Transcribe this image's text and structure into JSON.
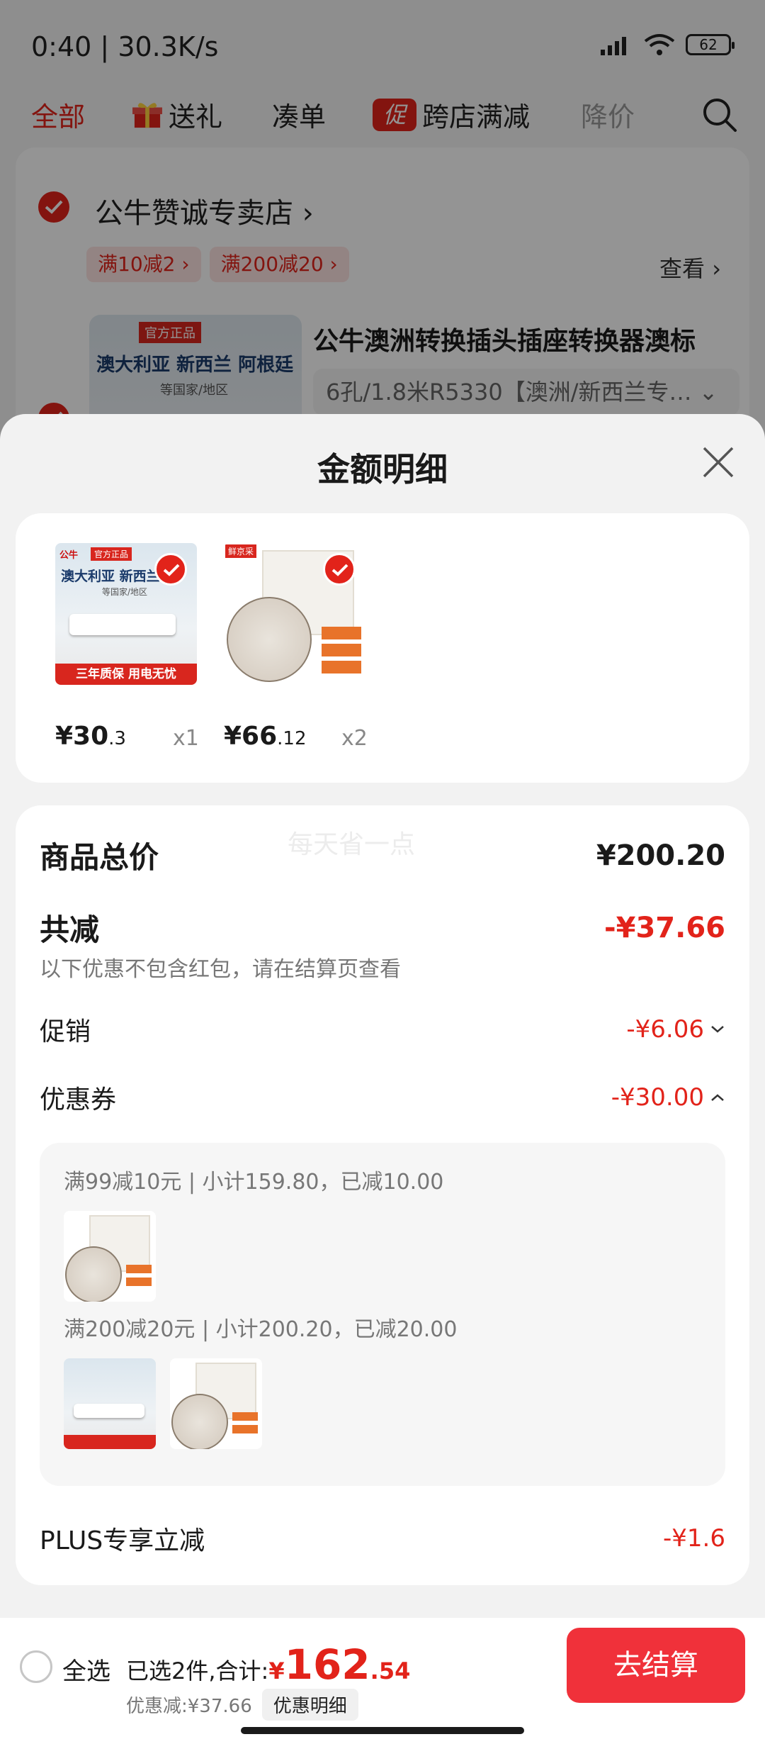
{
  "status_bar": {
    "time": "0:40",
    "speed": "30.3K/s",
    "battery": "62"
  },
  "tabs": [
    {
      "label": "全部"
    },
    {
      "label": "送礼"
    },
    {
      "label": "凑单"
    },
    {
      "label": "跨店满减",
      "badge": "促"
    },
    {
      "label": "降价"
    }
  ],
  "store": {
    "name": "公牛赞诚专卖店",
    "tags": [
      "满10减2",
      "满200减20"
    ],
    "view_label": "查看",
    "product_title": "公牛澳洲转换插头插座转换器澳标",
    "product_spec": "6孔/1.8米R5330【澳洲/新西兰专…",
    "thumb_region": "澳大利亚 新西兰 阿根廷",
    "thumb_sub": "等国家/地区",
    "thumb_tag": "官方正品"
  },
  "sheet": {
    "title": "金额明细",
    "items": [
      {
        "price_int": "¥30",
        "price_dec": ".3",
        "qty": "x1",
        "image": {
          "brand": "公牛",
          "tag": "官方正品",
          "region": "澳大利亚 新西兰",
          "sub": "等国家/地区",
          "banner": "三年质保 用电无忧"
        }
      },
      {
        "price_int": "¥66",
        "price_dec": ".12",
        "qty": "x2",
        "image": {
          "label": "鲜京采"
        }
      }
    ],
    "watermark": "每天省一点",
    "total_label": "商品总价",
    "total_value": "¥200.20",
    "discount_label": "共减",
    "discount_value": "-¥37.66",
    "discount_note": "以下优惠不包含红包，请在结算页查看",
    "promo_label": "促销",
    "promo_value": "-¥6.06",
    "coupon_label": "优惠券",
    "coupon_value": "-¥30.00",
    "coupon_lines": [
      "满99减10元 | 小计159.80，已减10.00",
      "满200减20元 | 小计200.20，已减20.00"
    ],
    "plus_label": "PLUS专享立减",
    "plus_value": "-¥1.6"
  },
  "footer": {
    "select_all": "全选",
    "selected_text": "已选2件,合计:",
    "yen": "¥",
    "total_int": "162",
    "total_dec": ".54",
    "discount_text": "优惠减:¥37.66",
    "detail_button": "优惠明细",
    "checkout_button": "去结算"
  },
  "colors": {
    "accent": "#e2231a",
    "checkout": "#f0313a"
  }
}
